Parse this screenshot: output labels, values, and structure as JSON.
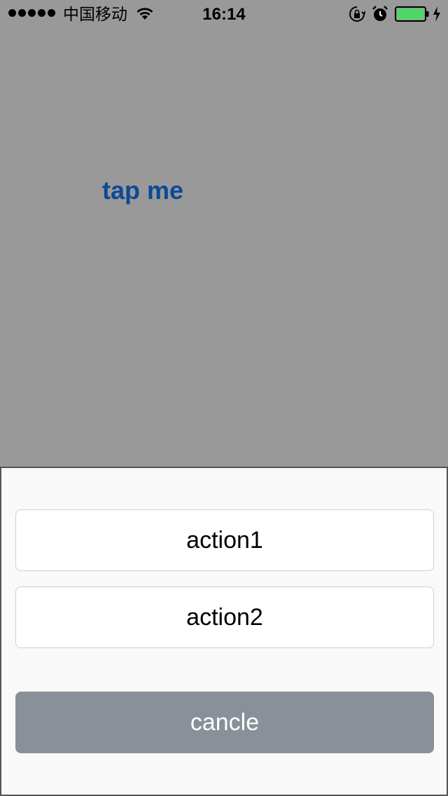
{
  "status_bar": {
    "carrier": "中国移动",
    "time": "16:14",
    "signal_bars": 5,
    "battery_level": 1.0,
    "battery_color": "#4cd964",
    "icons": [
      "signal-dots-icon",
      "wifi-icon",
      "rotation-lock-icon",
      "alarm-icon",
      "battery-icon",
      "charging-icon"
    ]
  },
  "main": {
    "tap_button_label": "tap me",
    "tap_button_color": "#0b4a96",
    "background_color": "#999999"
  },
  "action_sheet": {
    "actions": [
      {
        "label": "action1"
      },
      {
        "label": "action2"
      }
    ],
    "cancel_label": "cancle",
    "cancel_color": "#8a9099"
  }
}
